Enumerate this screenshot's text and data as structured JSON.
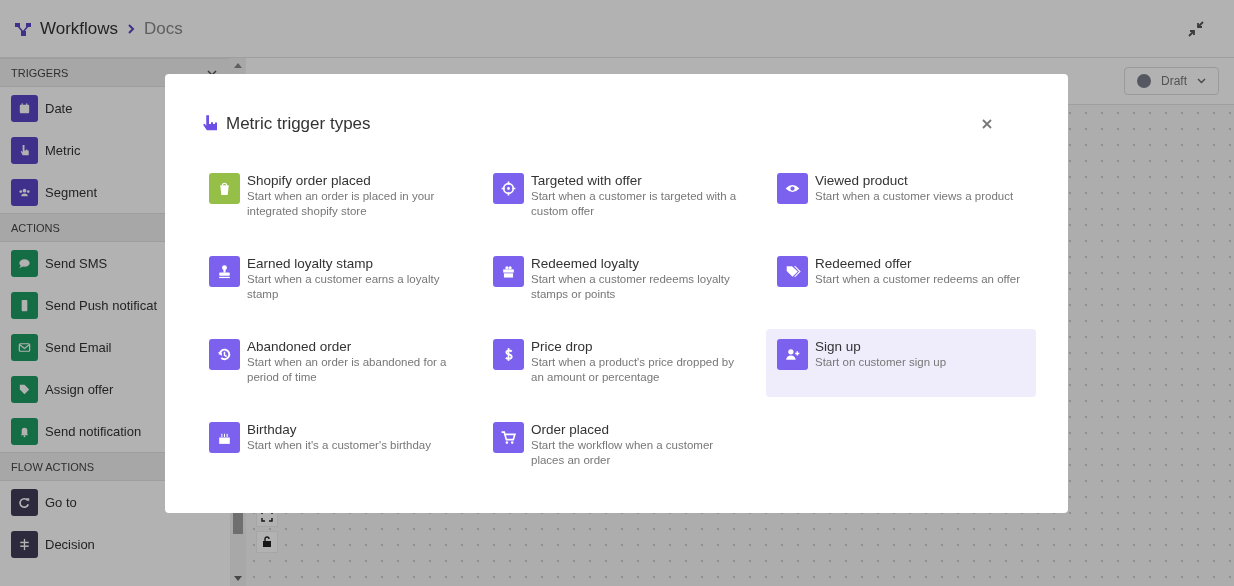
{
  "header": {
    "breadcrumb": [
      "Workflows",
      "Docs"
    ]
  },
  "sidebar": {
    "sections": [
      {
        "title": "TRIGGERS",
        "items": [
          {
            "label": "Date",
            "kind": "calendar"
          },
          {
            "label": "Metric",
            "kind": "pointer"
          },
          {
            "label": "Segment",
            "kind": "people"
          }
        ]
      },
      {
        "title": "ACTIONS",
        "items": [
          {
            "label": "Send SMS",
            "kind": "chat"
          },
          {
            "label": "Send Push notificat",
            "kind": "phone"
          },
          {
            "label": "Send Email",
            "kind": "mail"
          },
          {
            "label": "Assign offer",
            "kind": "tag"
          },
          {
            "label": "Send notification",
            "kind": "bell"
          }
        ]
      },
      {
        "title": "FLOW ACTIONS",
        "items": [
          {
            "label": "Go to",
            "kind": "redo"
          },
          {
            "label": "Decision",
            "kind": "signpost"
          }
        ]
      }
    ]
  },
  "canvas": {
    "status": {
      "label": "Draft"
    }
  },
  "modal": {
    "title": "Metric trigger types",
    "options": [
      {
        "title": "Shopify order placed",
        "description": "Start when an order is placed in your integrated shopify store",
        "kind": "shopify",
        "color": "#95bf47",
        "selected": false
      },
      {
        "title": "Targeted with offer",
        "description": "Start when a customer is targeted with a custom offer",
        "kind": "target",
        "color": "#7b61ee",
        "selected": false
      },
      {
        "title": "Viewed product",
        "description": "Start when a customer views a product",
        "kind": "eye",
        "color": "#7b61ee",
        "selected": false
      },
      {
        "title": "Earned loyalty stamp",
        "description": "Start when a customer earns a loyalty stamp",
        "kind": "stamp",
        "color": "#7b61ee",
        "selected": false
      },
      {
        "title": "Redeemed loyalty",
        "description": "Start when a customer redeems loyalty stamps or points",
        "kind": "gift",
        "color": "#7b61ee",
        "selected": false
      },
      {
        "title": "Redeemed offer",
        "description": "Start when a customer redeems an offer",
        "kind": "tags",
        "color": "#7b61ee",
        "selected": false
      },
      {
        "title": "Abandoned order",
        "description": "Start when an order is abandoned for a period of time",
        "kind": "history",
        "color": "#7b61ee",
        "selected": false
      },
      {
        "title": "Price drop",
        "description": "Start when a product's price dropped by an amount or percentage",
        "kind": "dollar",
        "color": "#7b61ee",
        "selected": false
      },
      {
        "title": "Sign up",
        "description": "Start on customer sign up",
        "kind": "user-plus",
        "color": "#7b61ee",
        "selected": true
      },
      {
        "title": "Birthday",
        "description": "Start when it's a customer's birthday",
        "kind": "cake",
        "color": "#7b61ee",
        "selected": false
      },
      {
        "title": "Order placed",
        "description": "Start the workflow when a customer places an order",
        "kind": "cart",
        "color": "#7b61ee",
        "selected": false
      }
    ]
  }
}
